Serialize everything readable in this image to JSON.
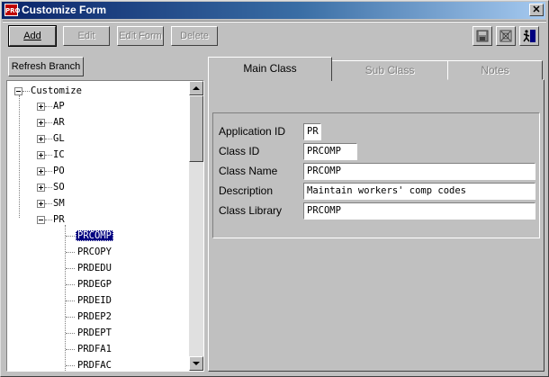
{
  "window": {
    "title": "Customize Form",
    "app_badge": "PRO"
  },
  "toolbar": {
    "add": "Add",
    "edit": "Edit",
    "edit_form": "Edit Form",
    "delete": "Delete"
  },
  "refresh_label": "Refresh Branch",
  "tree": {
    "root": "Customize",
    "modules": [
      "AP",
      "AR",
      "GL",
      "IC",
      "PO",
      "SO",
      "SM",
      "PR"
    ],
    "pr_children": [
      "PRCOMP",
      "PRCOPY",
      "PRDEDU",
      "PRDEGP",
      "PRDEID",
      "PRDEP2",
      "PRDEPT",
      "PRDFA1",
      "PRDFAC"
    ],
    "selected": "PRCOMP"
  },
  "tabs": [
    {
      "label": "Main Class",
      "active": true
    },
    {
      "label": "Sub Class",
      "active": false
    },
    {
      "label": "Notes",
      "active": false
    }
  ],
  "form": {
    "app_id_label": "Application ID",
    "app_id": "PR",
    "class_id_label": "Class ID",
    "class_id": "PRCOMP",
    "class_name_label": "Class Name",
    "class_name": "PRCOMP",
    "description_label": "Description",
    "description": "Maintain workers' comp codes",
    "class_library_label": "Class Library",
    "class_library": "PRCOMP"
  },
  "icons": {
    "save": "floppy-disk-icon",
    "reset": "reset-grid-icon",
    "exit": "exit-door-icon"
  },
  "colors": {
    "title_start": "#0a246a",
    "title_end": "#a6caf0",
    "selection": "#000080"
  }
}
